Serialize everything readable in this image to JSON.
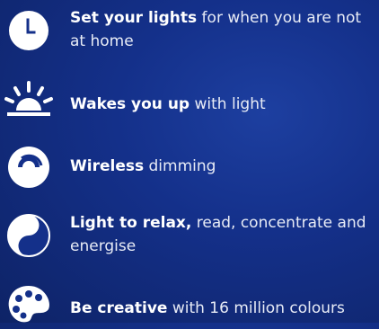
{
  "features": [
    {
      "bold": "Set your lights",
      "rest": " for when you are not at home",
      "icon": "clock-icon"
    },
    {
      "bold": "Wakes you up",
      "rest": " with light",
      "icon": "sunrise-icon"
    },
    {
      "bold": "Wireless",
      "rest": " dimming",
      "icon": "dimmer-icon"
    },
    {
      "bold": "Light to relax,",
      "rest": " read, concentrate and energise",
      "icon": "yin-yang-icon"
    },
    {
      "bold": "Be creative",
      "rest": " with 16 million colours",
      "icon": "palette-icon"
    }
  ],
  "colors": {
    "background_center": "#1d3fa0",
    "background_edge": "#0e2366",
    "text": "#ffffff"
  }
}
